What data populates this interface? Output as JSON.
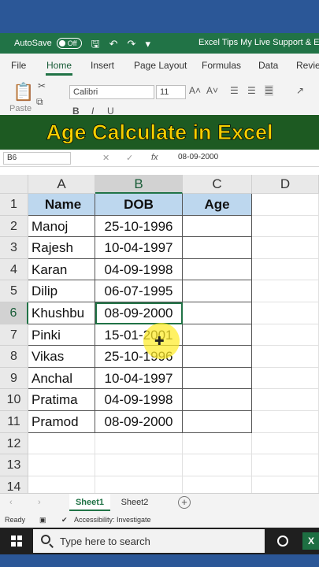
{
  "titlebar": {
    "autosave_label": "AutoSave",
    "toggle_label": "Off",
    "title": "Excel Tips My Live Support & EdBlog"
  },
  "ribbon_tabs": [
    "File",
    "Home",
    "Insert",
    "Page Layout",
    "Formulas",
    "Data",
    "Revie"
  ],
  "active_tab": "Home",
  "ribbon": {
    "paste_label": "Paste",
    "font_name": "Calibri",
    "font_size": "11"
  },
  "banner_title": "Age Calculate in Excel",
  "formula_bar": {
    "name_box": "B6",
    "formula_value": "08-09-2000"
  },
  "columns": [
    "A",
    "B",
    "C",
    "D"
  ],
  "selected_column": "B",
  "selected_row": 6,
  "rows": [
    {
      "num": "1",
      "a": "Name",
      "b": "DOB",
      "c": "Age",
      "header": true
    },
    {
      "num": "2",
      "a": "Manoj",
      "b": "25-10-1996",
      "c": ""
    },
    {
      "num": "3",
      "a": "Rajesh",
      "b": "10-04-1997",
      "c": ""
    },
    {
      "num": "4",
      "a": "Karan",
      "b": "04-09-1998",
      "c": ""
    },
    {
      "num": "5",
      "a": "Dilip",
      "b": "06-07-1995",
      "c": ""
    },
    {
      "num": "6",
      "a": "Khushbu",
      "b": "08-09-2000",
      "c": ""
    },
    {
      "num": "7",
      "a": "Pinki",
      "b": "15-01-2001",
      "c": ""
    },
    {
      "num": "8",
      "a": "Vikas",
      "b": "25-10-1996",
      "c": ""
    },
    {
      "num": "9",
      "a": "Anchal",
      "b": "10-04-1997",
      "c": ""
    },
    {
      "num": "10",
      "a": "Pratima",
      "b": "04-09-1998",
      "c": ""
    },
    {
      "num": "11",
      "a": "Pramod",
      "b": "08-09-2000",
      "c": ""
    },
    {
      "num": "12",
      "a": "",
      "b": "",
      "c": ""
    },
    {
      "num": "13",
      "a": "",
      "b": "",
      "c": ""
    },
    {
      "num": "14",
      "a": "",
      "b": "",
      "c": ""
    }
  ],
  "sheet_tabs": [
    "Sheet1",
    "Sheet2"
  ],
  "active_sheet": "Sheet1",
  "status": {
    "ready": "Ready",
    "accessibility": "Accessibility: Investigate"
  },
  "taskbar": {
    "search_placeholder": "Type here to search"
  },
  "colors": {
    "excel_green": "#217346",
    "banner_bg": "#1d5a22",
    "banner_text": "#f5cf00",
    "header_fill": "#bdd7ee"
  }
}
